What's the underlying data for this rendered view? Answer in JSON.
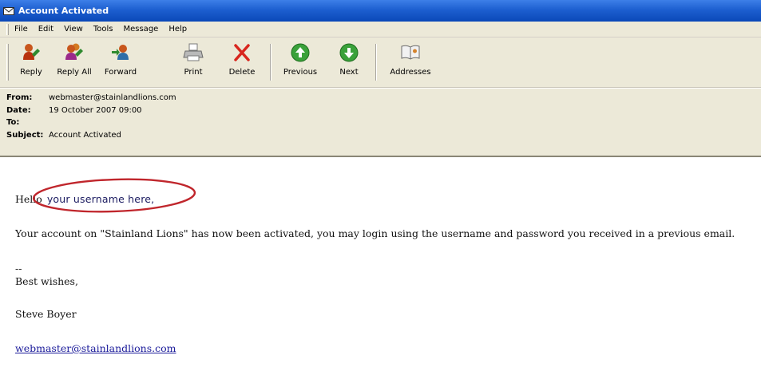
{
  "window": {
    "title": "Account Activated",
    "icon": "envelope-icon"
  },
  "menu": [
    "File",
    "Edit",
    "View",
    "Tools",
    "Message",
    "Help"
  ],
  "toolbar": {
    "reply": "Reply",
    "reply_all": "Reply All",
    "forward": "Forward",
    "print": "Print",
    "delete": "Delete",
    "previous": "Previous",
    "next": "Next",
    "addresses": "Addresses"
  },
  "header": {
    "from_label": "From:",
    "from_value": "webmaster@stainlandlions.com",
    "date_label": "Date:",
    "date_value": "19 October 2007 09:00",
    "to_label": "To:",
    "to_value": "",
    "subject_label": "Subject:",
    "subject_value": "Account Activated"
  },
  "message": {
    "greeting_prefix": "Hello",
    "username": "your username here,",
    "body_text": "Your account on \"Stainland Lions\" has now been activated, you may login using the username and password you received in a previous email.",
    "separator": "--",
    "closing": "Best wishes,",
    "sender_name": "Steve Boyer",
    "signature_link": "webmaster@stainlandlions.com"
  },
  "colors": {
    "titlebar": "#1d5fd0",
    "chrome": "#ece9d8",
    "highlight_ellipse": "#c0262c",
    "link": "#1a1a9a"
  }
}
